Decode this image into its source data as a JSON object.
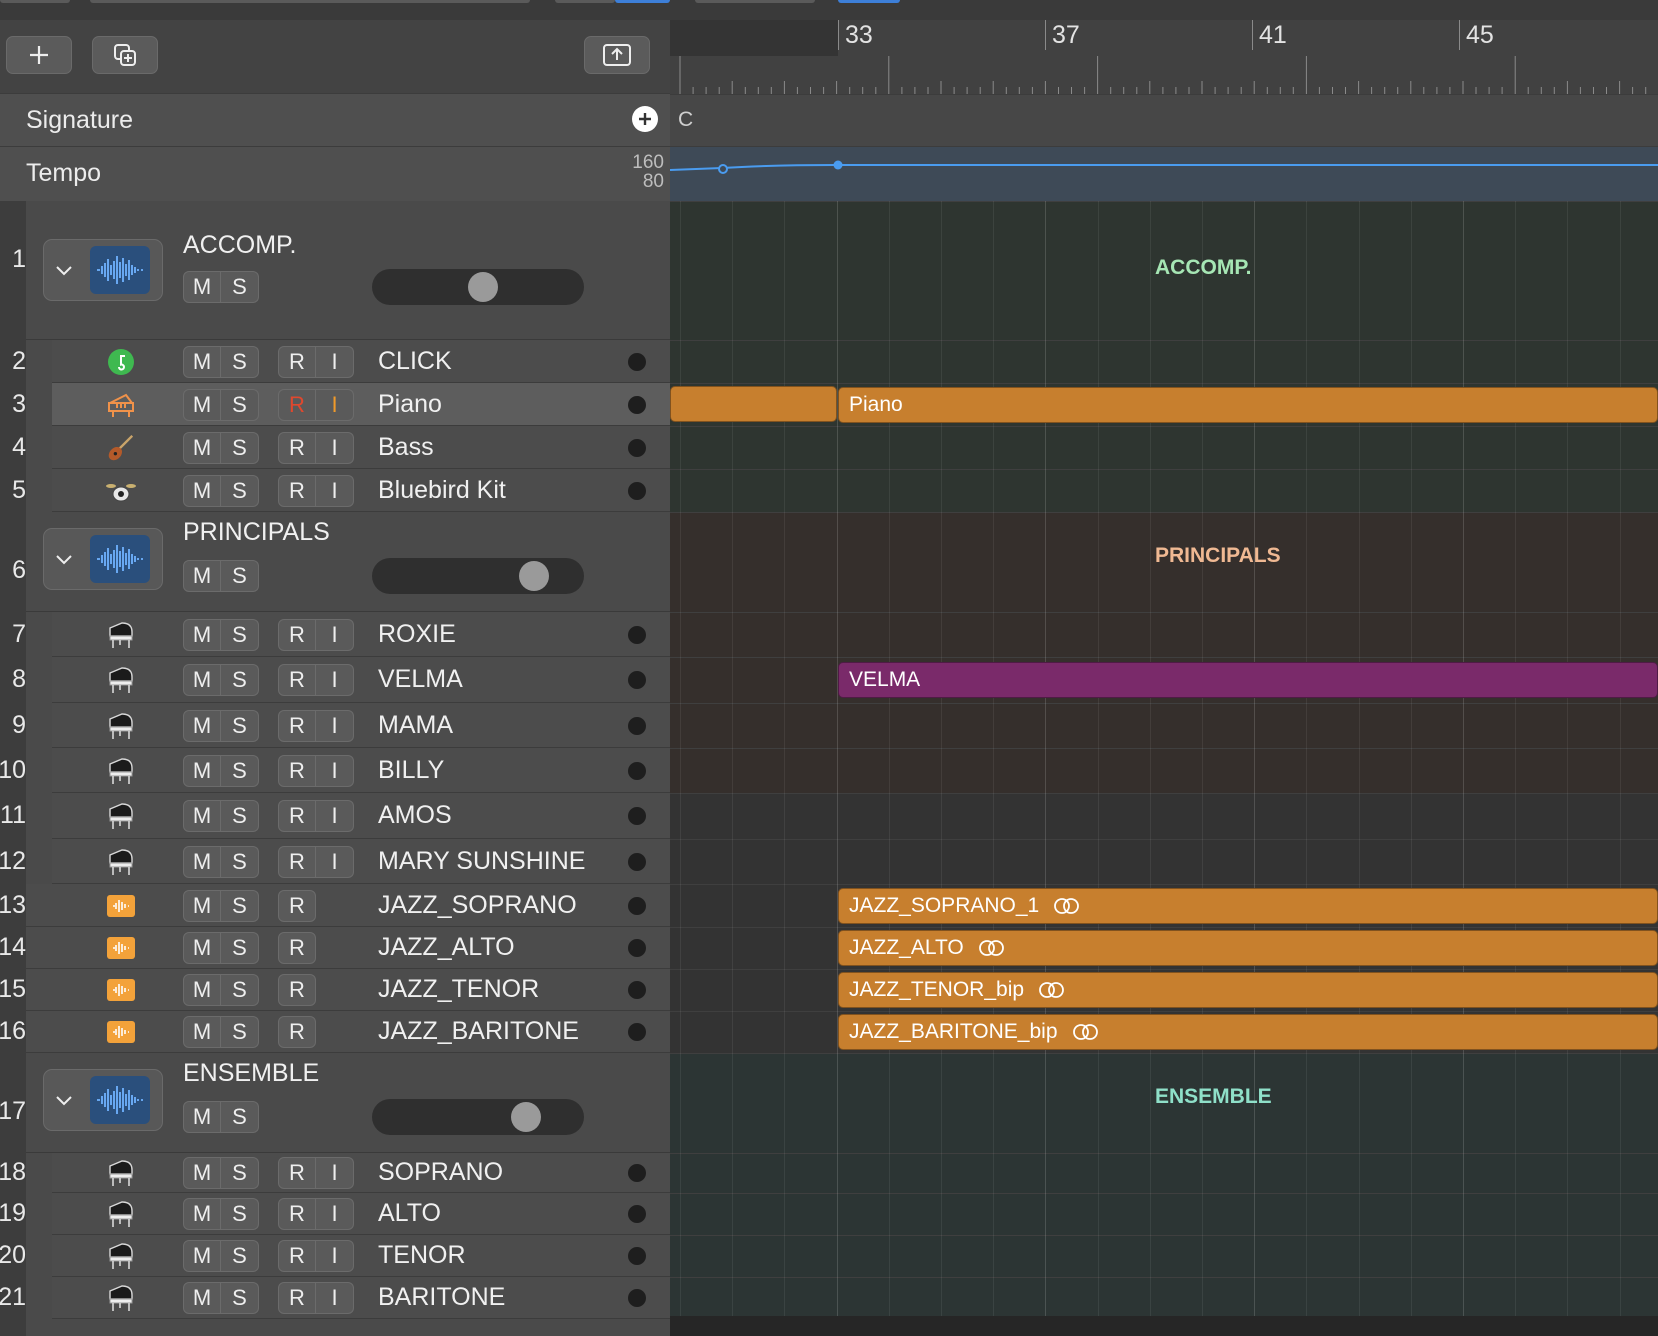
{
  "colors": {
    "region_orange": "#c77f2e",
    "region_purple": "#7a2a6a",
    "accomp_label": "#a6e6b4",
    "principals_label": "#f0b993",
    "ensemble_label": "#8fe0c9",
    "tempo_line": "#4a9cf0",
    "click_icon": "#3fb950",
    "audio_icon": "#f3a23a"
  },
  "toolbar": {
    "add_icon": "plus-icon",
    "duplicate_icon": "duplicate-icon",
    "collapse_icon": "upload-tray-icon"
  },
  "global_tracks": {
    "signature_label": "Signature",
    "tempo_label": "Tempo",
    "tempo_max": "160",
    "tempo_min": "80",
    "key_signature": "C"
  },
  "ruler": {
    "bars": [
      "33",
      "37",
      "41",
      "45"
    ]
  },
  "buttons": {
    "mute": "M",
    "solo": "S",
    "record": "R",
    "input": "I"
  },
  "groups": [
    {
      "number": "1",
      "name": "ACCOMP.",
      "lane_label": "ACCOMP.",
      "volume_level": 0.53
    },
    {
      "number": "6",
      "name": "PRINCIPALS",
      "lane_label": "PRINCIPALS",
      "volume_level": 0.82
    },
    {
      "number": "17",
      "name": "ENSEMBLE",
      "lane_label": "ENSEMBLE",
      "volume_level": 0.77
    }
  ],
  "tracks": [
    {
      "number": "2",
      "name": "CLICK",
      "icon": "metronome-icon"
    },
    {
      "number": "3",
      "name": "Piano",
      "icon": "keyboard-icon",
      "region": "Piano"
    },
    {
      "number": "4",
      "name": "Bass",
      "icon": "bass-guitar-icon"
    },
    {
      "number": "5",
      "name": "Bluebird Kit",
      "icon": "drum-kit-icon"
    },
    {
      "number": "7",
      "name": "ROXIE",
      "icon": "grand-piano-icon"
    },
    {
      "number": "8",
      "name": "VELMA",
      "icon": "grand-piano-icon",
      "region": "VELMA"
    },
    {
      "number": "9",
      "name": "MAMA",
      "icon": "grand-piano-icon"
    },
    {
      "number": "10",
      "name": "BILLY",
      "icon": "grand-piano-icon"
    },
    {
      "number": "11",
      "name": "AMOS",
      "icon": "grand-piano-icon"
    },
    {
      "number": "12",
      "name": "MARY SUNSHINE",
      "icon": "grand-piano-icon"
    },
    {
      "number": "13",
      "name": "JAZZ_SOPRANO",
      "icon": "audio-waveform-icon",
      "region": "JAZZ_SOPRANO_1"
    },
    {
      "number": "14",
      "name": "JAZZ_ALTO",
      "icon": "audio-waveform-icon",
      "region": "JAZZ_ALTO"
    },
    {
      "number": "15",
      "name": "JAZZ_TENOR",
      "icon": "audio-waveform-icon",
      "region": "JAZZ_TENOR_bip"
    },
    {
      "number": "16",
      "name": "JAZZ_BARITONE",
      "icon": "audio-waveform-icon",
      "region": "JAZZ_BARITONE_bip"
    },
    {
      "number": "18",
      "name": "SOPRANO",
      "icon": "grand-piano-icon"
    },
    {
      "number": "19",
      "name": "ALTO",
      "icon": "grand-piano-icon"
    },
    {
      "number": "20",
      "name": "TENOR",
      "icon": "grand-piano-icon"
    },
    {
      "number": "21",
      "name": "BARITONE",
      "icon": "grand-piano-icon"
    }
  ]
}
